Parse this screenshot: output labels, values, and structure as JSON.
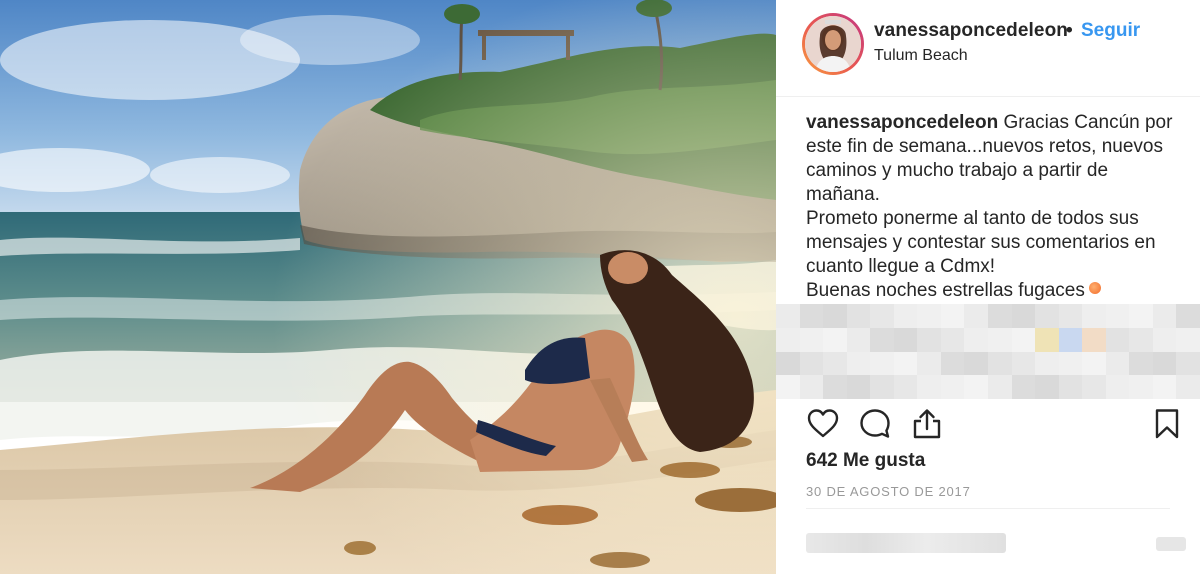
{
  "post": {
    "username": "vanessaponcedeleon",
    "separator": "•",
    "follow_label": "Seguir",
    "location": "Tulum Beach"
  },
  "caption": {
    "username": "vanessaponcedeleon",
    "line1": "Gracias Cancún por este fin de semana...nuevos retos, nuevos caminos y mucho trabajo a partir de mañana.",
    "line2": "Prometo ponerme al tanto de todos sus mensajes y contestar sus comentarios en cuanto llegue a Cdmx!",
    "line3": "Buenas noches estrellas fugaces"
  },
  "actions": {
    "like_icon": "heart-icon",
    "comment_icon": "comment-icon",
    "share_icon": "share-icon",
    "save_icon": "bookmark-icon"
  },
  "likes_text": "642 Me gusta",
  "date": "30 DE AGOSTO DE 2017",
  "colors": {
    "link_blue": "#3897f0",
    "text": "#262626",
    "muted": "#999999",
    "divider": "#efefef"
  }
}
